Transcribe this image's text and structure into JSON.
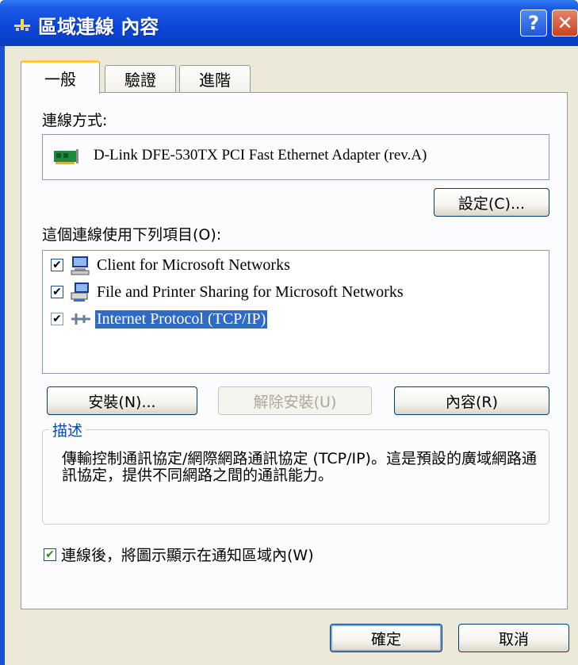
{
  "window": {
    "title": "區域連線 內容",
    "help_label": "?",
    "close_label": "✕"
  },
  "tabs": [
    {
      "label": "一般",
      "active": true
    },
    {
      "label": "驗證",
      "active": false
    },
    {
      "label": "進階",
      "active": false
    }
  ],
  "general": {
    "connect_using_label": "連線方式:",
    "adapter_name": "D-Link DFE-530TX PCI Fast Ethernet Adapter (rev.A)",
    "configure_button": "設定(C)...",
    "components_label": "這個連線使用下列項目(O):",
    "components": [
      {
        "label": "Client for Microsoft Networks",
        "checked": true,
        "icon": "network-client-icon",
        "selected": false,
        "check_mark": "✔"
      },
      {
        "label": "File and Printer Sharing for Microsoft Networks",
        "checked": true,
        "icon": "file-printer-sharing-icon",
        "selected": false,
        "check_mark": "✔"
      },
      {
        "label": "Internet Protocol (TCP/IP)",
        "checked": true,
        "icon": "protocol-icon",
        "selected": true,
        "check_mark": "✔"
      }
    ],
    "install_button": "安裝(N)...",
    "uninstall_button": "解除安裝(U)",
    "properties_button": "內容(R)",
    "description_title": "描述",
    "description_text": "傳輸控制通訊協定/網際網路通訊協定 (TCP/IP)。這是預設的廣域網路通訊協定，提供不同網路之間的通訊能力。",
    "show_icon_label": "連線後，將圖示顯示在通知區域內(W)",
    "show_icon_checked": true,
    "show_icon_check_mark": "✔"
  },
  "footer": {
    "ok_button": "確定",
    "cancel_button": "取消"
  },
  "colors": {
    "title_bar": "#0c47d8",
    "selection": "#316ac5",
    "dialog_bg": "#ece9d8"
  }
}
